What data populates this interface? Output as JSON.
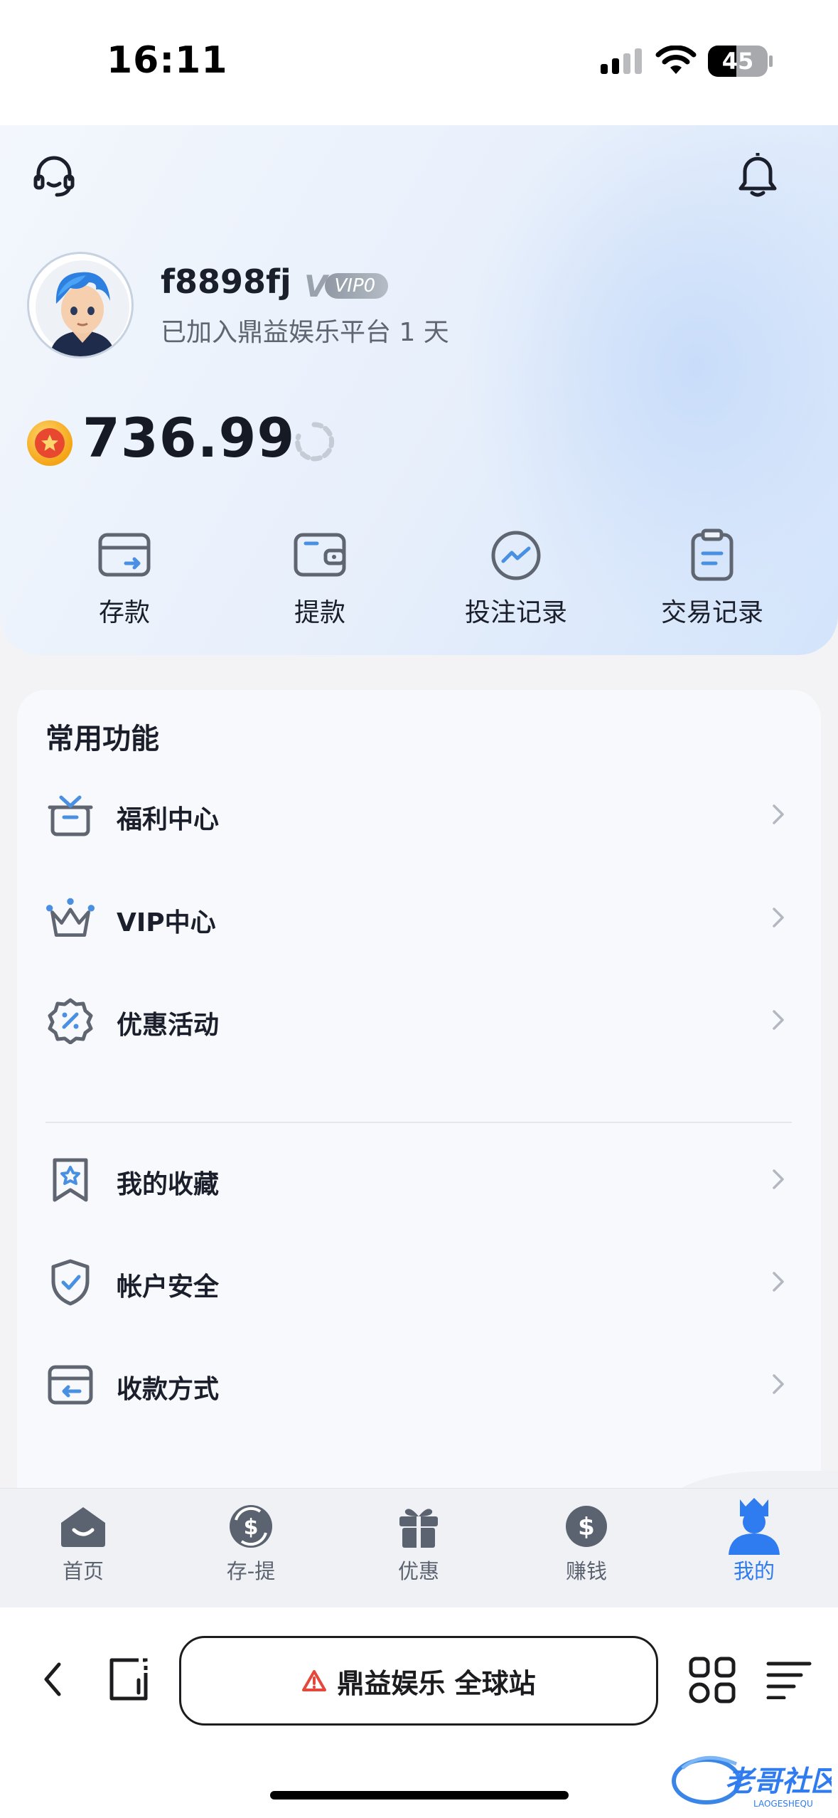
{
  "status": {
    "time": "16:11",
    "battery": "45"
  },
  "header": {
    "username": "f8898fj",
    "vip_level": "VIP0",
    "joined": "已加入鼎益娱乐平台 1 天",
    "balance": "736.99"
  },
  "actions": [
    {
      "label": "存款",
      "icon": "deposit-card-icon"
    },
    {
      "label": "提款",
      "icon": "wallet-icon"
    },
    {
      "label": "投注记录",
      "icon": "trend-chart-icon"
    },
    {
      "label": "交易记录",
      "icon": "clipboard-icon"
    }
  ],
  "functions": {
    "title": "常用功能",
    "items": [
      {
        "label": "福利中心",
        "icon": "gift-box-icon"
      },
      {
        "label": "VIP中心",
        "icon": "crown-icon"
      },
      {
        "label": "优惠活动",
        "icon": "discount-badge-icon"
      },
      {
        "label": "我的收藏",
        "icon": "bookmark-star-icon"
      },
      {
        "label": "帐户安全",
        "icon": "shield-check-icon"
      },
      {
        "label": "收款方式",
        "icon": "payment-card-icon"
      }
    ]
  },
  "tabbar": [
    {
      "label": "首页",
      "icon": "home-icon",
      "active": false
    },
    {
      "label": "存-提",
      "icon": "exchange-icon",
      "active": false
    },
    {
      "label": "优惠",
      "icon": "gift-icon",
      "active": false
    },
    {
      "label": "赚钱",
      "icon": "dollar-coin-icon",
      "active": false
    },
    {
      "label": "我的",
      "icon": "user-crown-icon",
      "active": true
    }
  ],
  "browser": {
    "url_title": "鼎益娱乐 全球站"
  },
  "colors": {
    "accent": "#2f7bf0",
    "icon_blue": "#4a90e2",
    "text": "#1a1f2b",
    "muted": "#5f6672"
  }
}
